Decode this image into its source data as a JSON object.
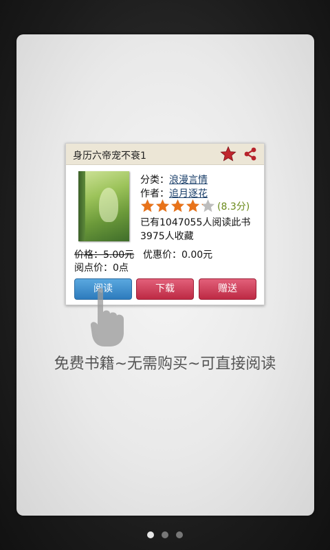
{
  "card": {
    "title": "身历六帝宠不衰1",
    "category_label": "分类：",
    "category": "浪漫言情",
    "author_label": "作者：",
    "author": "追月逐花",
    "rating": 4.15,
    "rating_max": 5,
    "score": "(8.3分)",
    "readers": "已有1047055人阅读此书",
    "collects": "3975人收藏",
    "price": "价格：5.00元",
    "discount": "优惠价：0.00元",
    "points": "阅点价：0点",
    "buttons": {
      "read": "阅读",
      "download": "下载",
      "gift": "赠送"
    }
  },
  "caption": "免费书籍~无需购买~可直接阅读",
  "pager": {
    "total": 3,
    "active": 0
  },
  "colors": {
    "star": "#e8731a",
    "fav": "#c0262d",
    "read_button": "#2d7bbd",
    "red_button": "#bd2a44"
  }
}
